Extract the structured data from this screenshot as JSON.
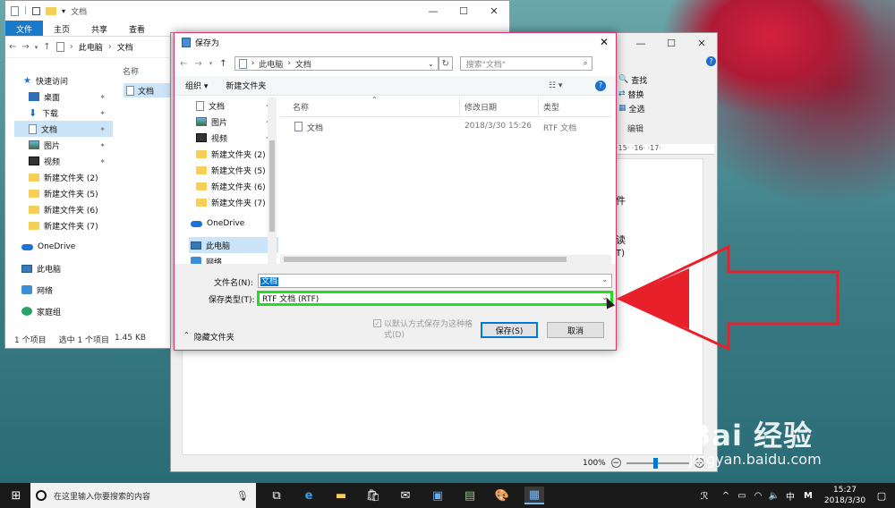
{
  "explorer": {
    "title": "文档",
    "ribbon_tabs": [
      "文件",
      "主页",
      "共享",
      "查看"
    ],
    "breadcrumb": [
      "此电脑",
      "文档"
    ],
    "column_name": "名称",
    "nav": [
      {
        "label": "快速访问",
        "icon": "star-icon"
      },
      {
        "label": "桌面",
        "icon": "desktop-icon",
        "pinned": true
      },
      {
        "label": "下载",
        "icon": "download-icon",
        "pinned": true
      },
      {
        "label": "文档",
        "icon": "document-icon",
        "pinned": true,
        "selected": true
      },
      {
        "label": "图片",
        "icon": "pictures-icon",
        "pinned": true
      },
      {
        "label": "视频",
        "icon": "videos-icon",
        "pinned": true
      },
      {
        "label": "新建文件夹 (2)",
        "icon": "folder-icon"
      },
      {
        "label": "新建文件夹 (5)",
        "icon": "folder-icon"
      },
      {
        "label": "新建文件夹 (6)",
        "icon": "folder-icon"
      },
      {
        "label": "新建文件夹 (7)",
        "icon": "folder-icon"
      },
      {
        "label": "OneDrive",
        "icon": "onedrive-icon"
      },
      {
        "label": "此电脑",
        "icon": "this-pc-icon"
      },
      {
        "label": "网络",
        "icon": "network-icon"
      },
      {
        "label": "家庭组",
        "icon": "homegroup-icon"
      }
    ],
    "file": "文档",
    "status": {
      "count": "1 个项目",
      "selected": "选中 1 个项目",
      "size": "1.45 KB"
    }
  },
  "wordpad": {
    "ribbon": [
      "查找",
      "替换",
      "全选"
    ],
    "group": "编辑",
    "ruler": "·15·  ·16·  ·17·",
    "doc_fragments": [
      "件",
      "读",
      "T)"
    ],
    "zoom": "100%"
  },
  "dialog": {
    "title": "保存为",
    "breadcrumb": [
      "此电脑",
      "文档"
    ],
    "search_placeholder": "搜索\"文档\"",
    "organize": "组织",
    "new_folder": "新建文件夹",
    "nav": [
      {
        "label": "文档",
        "icon": "document-icon",
        "pinned": true
      },
      {
        "label": "图片",
        "icon": "pictures-icon",
        "pinned": true
      },
      {
        "label": "视频",
        "icon": "videos-icon",
        "pinned": true
      },
      {
        "label": "新建文件夹 (2)",
        "icon": "folder-icon"
      },
      {
        "label": "新建文件夹 (5)",
        "icon": "folder-icon"
      },
      {
        "label": "新建文件夹 (6)",
        "icon": "folder-icon"
      },
      {
        "label": "新建文件夹 (7)",
        "icon": "folder-icon"
      },
      {
        "label": "OneDrive",
        "icon": "onedrive-icon"
      },
      {
        "label": "此电脑",
        "icon": "this-pc-icon",
        "selected": true
      },
      {
        "label": "网络",
        "icon": "network-icon"
      }
    ],
    "columns": [
      "名称",
      "修改日期",
      "类型"
    ],
    "files": [
      {
        "name": "文档",
        "date": "2018/3/30 15:26",
        "type": "RTF 文档"
      }
    ],
    "filename_label": "文件名(N):",
    "filename_value": "文档",
    "filetype_label": "保存类型(T):",
    "filetype_value": "RTF 文档 (RTF)",
    "default_checkbox": "以默认方式保存为这种格式(D)",
    "hide_folders": "隐藏文件夹",
    "save": "保存(S)",
    "cancel": "取消",
    "highlight_color": "#22dd22"
  },
  "annotation": {
    "arrow_color": "#e8202a"
  },
  "taskbar": {
    "search_placeholder": "在这里输入你要搜索的内容",
    "tray_ime": "中",
    "tray_m": "M",
    "time": "15:27",
    "date": "2018/3/30"
  },
  "watermark": {
    "brand": "Bai 经验",
    "url": "jingyan.baidu.com"
  }
}
